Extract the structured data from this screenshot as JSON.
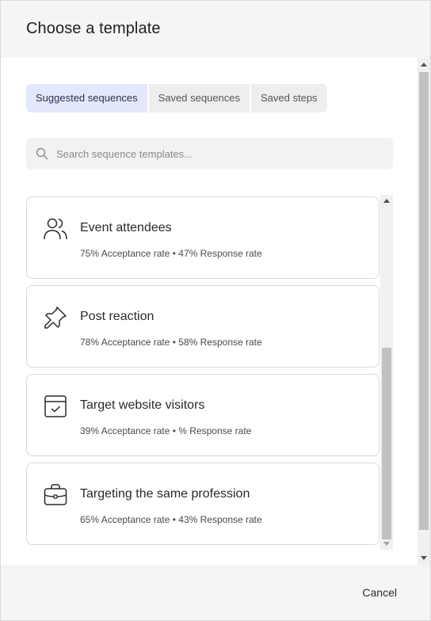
{
  "dialog": {
    "title": "Choose a template"
  },
  "tabs": [
    {
      "label": "Suggested sequences",
      "active": true
    },
    {
      "label": "Saved sequences",
      "active": false
    },
    {
      "label": "Saved steps",
      "active": false
    }
  ],
  "search": {
    "placeholder": "Search sequence templates...",
    "value": ""
  },
  "templates": [
    {
      "name": "Event attendees",
      "stats": "75% Acceptance rate • 47% Response rate",
      "icon": "people-icon"
    },
    {
      "name": "Post reaction",
      "stats": "78% Acceptance rate • 58% Response rate",
      "icon": "pin-icon"
    },
    {
      "name": "Target website visitors",
      "stats": "39% Acceptance rate • % Response rate",
      "icon": "browser-check-icon"
    },
    {
      "name": "Targeting the same profession",
      "stats": "65% Acceptance rate • 43% Response rate",
      "icon": "briefcase-icon"
    }
  ],
  "footer": {
    "cancel_label": "Cancel"
  },
  "colors": {
    "header_bg": "#f4f5f7",
    "active_tab_bg": "#e3e8ff",
    "tab_bg": "#eeeeee",
    "card_border": "#d9d9d9"
  }
}
